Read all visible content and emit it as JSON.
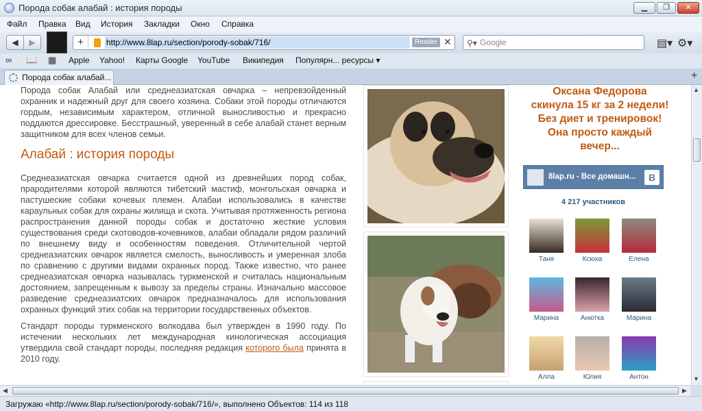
{
  "window": {
    "title": "Порода собак алабай : история породы",
    "btn_minimize": "▁",
    "btn_restore": "❐",
    "btn_close": "✕"
  },
  "menu": [
    "Файл",
    "Правка",
    "Вид",
    "История",
    "Закладки",
    "Окно",
    "Справка"
  ],
  "toolbar": {
    "back_icon": "◀",
    "forward_icon": "▶",
    "add_icon": "+",
    "url": "http://www.8lap.ru/section/porody-sobak/716/",
    "reader_label": "Reader",
    "clear_icon": "✕",
    "search_placeholder": "Google",
    "search_icon": "⚲▾",
    "page_menu_icon": "▤▾",
    "settings_icon": "⚙▾"
  },
  "bookmarks": {
    "icons": [
      "∞",
      "📖",
      "▦"
    ],
    "items": [
      "Apple",
      "Yahoo!",
      "Карты Google",
      "YouTube",
      "Википедия",
      "Популярн... ресурсы ▾"
    ]
  },
  "tab": {
    "label": "Порода собак алабай...",
    "new_tab_icon": "+"
  },
  "article": {
    "intro": "Порода собак Алабай или среднеазиатская овчарка – непревзойденный охранник и надежный друг для своего хозяина. Собаки этой породы отличаются гордым, независимым характером, отличной выносливостью и прекрасно поддаются дрессировке. Бесстрашный, уверенный в себе алабай станет верным защитником для всех членов семьи.",
    "heading": "Алабай : история породы",
    "para1": "Среднеазиатская овчарка считается одной из древнейших пород собак, прародителями которой являются тибетский мастиф, монгольская овчарка и пастушеские собаки кочевых племен. Алабаи использовались в качестве караульных собак для охраны жилища и скота. Учитывая протяженность региона распространения данной породы собак и достаточно жесткие условия существования среди скотоводов-кочевников, алабаи обладали рядом различий по внешнему виду и особенностям поведения. Отличительной чертой среднеазиатских овчарок является смелость, выносливость и умеренная злоба по сравнению с другими видами охранных пород. Также известно, что ранее среднеазиатская овчарка называлась туркменской и считалась национальным достоянием, запрещенным к вывозу за пределы страны. Изначально массовое разведение среднеазиатских овчарок предназначалось для использования охранных функций этих собак на территории государственных объектов.",
    "para2_before": "Стандарт породы туркменского волкодава был утвержден в 1990 году. По истечении нескольких лет международная кинологическая ассоциация утвердила свой стандарт породы, последняя редакция ",
    "para2_link": "которого была",
    "para2_after": " принята в 2010 году."
  },
  "sidebar": {
    "promo": [
      "Оксана Федорова",
      "скинула 15 кг за 2 недели!",
      "Без диет и тренировок!",
      "Она просто каждый",
      "вечер..."
    ],
    "vk_title": "8lap.ru - Все домашн...",
    "vk_letter": "B",
    "members_count": "4 217 участников",
    "members": [
      "Таня",
      "Ксюха",
      "Елена",
      "Марина",
      "Анютка",
      "Марина",
      "Алла",
      "Юлия",
      "Антон"
    ]
  },
  "scroll": {
    "up": "▲",
    "down": "▼",
    "left": "◀",
    "right": "▶"
  },
  "status": "Загружаю «http://www.8lap.ru/section/porody-sobak/716/», выполнено Объектов: 114 из 118"
}
